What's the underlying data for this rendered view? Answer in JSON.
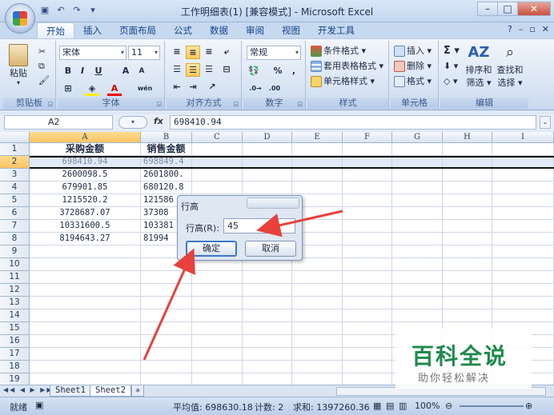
{
  "window": {
    "title": "工作明细表(1)  [兼容模式] - Microsoft Excel"
  },
  "tabs": [
    "开始",
    "插入",
    "页面布局",
    "公式",
    "数据",
    "审阅",
    "视图",
    "开发工具"
  ],
  "ribbon": {
    "clipboard": {
      "label": "剪贴板",
      "paste": "粘贴"
    },
    "font": {
      "label": "字体",
      "name": "宋体",
      "size": "11",
      "bold": "B",
      "italic": "I",
      "underline": "U",
      "grow": "A",
      "shrink": "A",
      "color_a": "A",
      "wen": "wén"
    },
    "alignment": {
      "label": "对齐方式"
    },
    "number": {
      "label": "数字",
      "format": "常规",
      "percent": "%",
      "comma": ","
    },
    "styles": {
      "label": "样式",
      "conditional": "条件格式",
      "table": "套用表格格式",
      "cell": "单元格样式"
    },
    "cells": {
      "label": "单元格",
      "insert": "插入",
      "delete": "删除",
      "format": "格式"
    },
    "editing": {
      "label": "编辑",
      "sigma": "Σ",
      "sort": "排序和",
      "sort2": "筛选",
      "find": "查找和",
      "find2": "选择"
    }
  },
  "formula_bar": {
    "name_box": "A2",
    "fx": "fx",
    "value": "698410.94"
  },
  "columns": [
    "A",
    "B",
    "C",
    "D",
    "E",
    "F",
    "G",
    "H",
    "I"
  ],
  "rows": [
    "1",
    "2",
    "3",
    "4",
    "5",
    "6",
    "7",
    "8",
    "9",
    "10",
    "11",
    "12",
    "13",
    "14",
    "15",
    "16",
    "17",
    "18",
    "19"
  ],
  "cells": {
    "headers": [
      "采购金额",
      "销售金额"
    ],
    "data": [
      [
        "698410.94",
        "698849.4"
      ],
      [
        "2600098.5",
        "2601800."
      ],
      [
        "679901.85",
        "680120.8"
      ],
      [
        "1215520.2",
        "121586"
      ],
      [
        "3728687.07",
        "37308"
      ],
      [
        "10331600.5",
        "103381"
      ],
      [
        "8194643.27",
        "81994"
      ]
    ]
  },
  "dialog": {
    "title": "行高",
    "field_label": "行高(R):",
    "value": "45",
    "ok": "确定",
    "cancel": "取消"
  },
  "sheets": [
    "Sheet1",
    "Sheet2"
  ],
  "status": {
    "mode": "就绪",
    "average": "平均值: 698630.18",
    "count": "计数: 2",
    "sum": "求和: 1397260.36",
    "zoom": "100%"
  },
  "watermark": {
    "big": "百科全说",
    "small": "助你轻松解决"
  },
  "colors": {
    "accent": "#1f8a4c",
    "arrow": "#e8413c",
    "selection": "#f8c463"
  }
}
